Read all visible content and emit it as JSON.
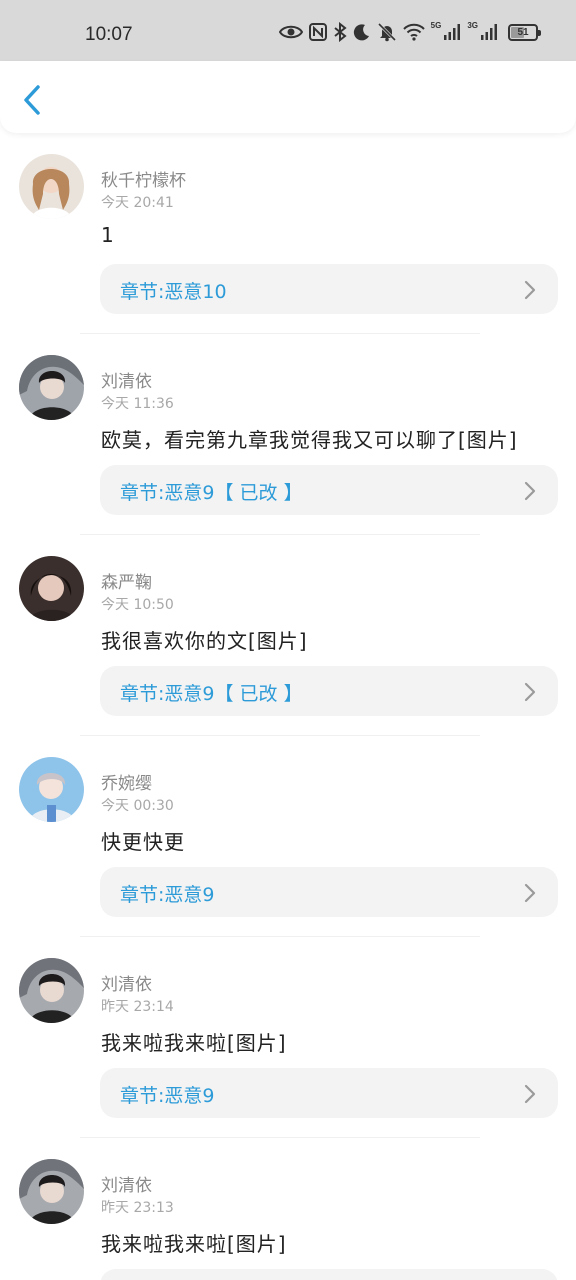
{
  "status_bar": {
    "time": "10:07",
    "network_1": "5G",
    "network_2": "3G",
    "battery": "51",
    "icons": [
      "eye-icon",
      "nfc-icon",
      "bluetooth-icon",
      "moon-icon",
      "bell-off-icon",
      "wifi-icon",
      "signal-icon",
      "signal-icon",
      "battery-icon"
    ]
  },
  "nav": {
    "back_icon": "chevron-left-icon"
  },
  "colors": {
    "accent": "#2d9bd8",
    "card_bg": "#f3f3f3",
    "status_bg": "#d9d9d9"
  },
  "comments": [
    {
      "name": "秋千柠檬杯",
      "time": "今天  20:41",
      "text": "1",
      "chapter": "章节:恶意10"
    },
    {
      "name": "刘清依",
      "time": "今天  11:36",
      "text": "欧莫，看完第九章我觉得我又可以聊了[图片]",
      "chapter": "章节:恶意9【 已改 】"
    },
    {
      "name": "森严鞠",
      "time": "今天  10:50",
      "text": "我很喜欢你的文[图片]",
      "chapter": "章节:恶意9【 已改 】"
    },
    {
      "name": "乔婉缨",
      "time": "今天  00:30",
      "text": "快更快更",
      "chapter": "章节:恶意9"
    },
    {
      "name": "刘清依",
      "time": "昨天  23:14",
      "text": "我来啦我来啦[图片]",
      "chapter": "章节:恶意9"
    },
    {
      "name": "刘清依",
      "time": "昨天  23:13",
      "text": "我来啦我来啦[图片]",
      "chapter": ""
    }
  ]
}
